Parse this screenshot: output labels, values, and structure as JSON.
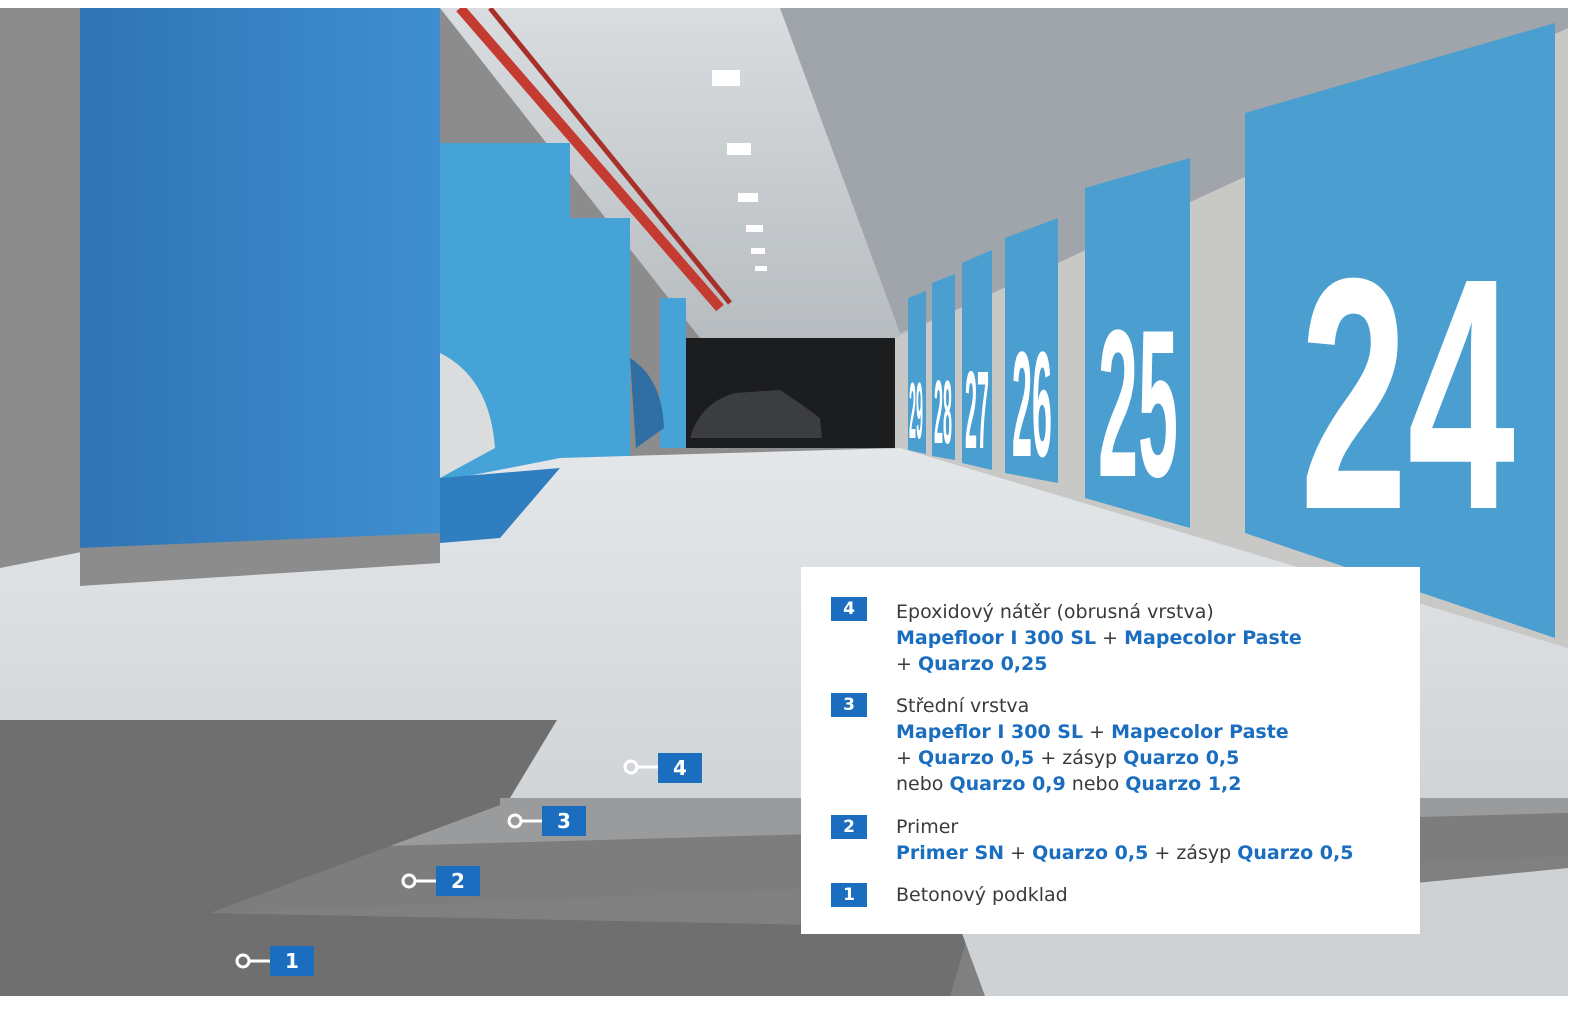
{
  "doors": [
    "24",
    "25",
    "26",
    "27",
    "28",
    "29"
  ],
  "floor_tags": [
    "4",
    "3",
    "2",
    "1"
  ],
  "legend": [
    {
      "num": "4",
      "title": "Epoxidový nátěr (obrusná vrstva)",
      "line1": [
        "Mapefloor I 300 SL",
        " + ",
        "Mapecolor Paste"
      ],
      "line2": [
        "+ ",
        "Quarzo 0,25"
      ]
    },
    {
      "num": "3",
      "title": "Střední vrstva",
      "line1": [
        "Mapeflor I 300 SL",
        " + ",
        "Mapecolor Paste"
      ],
      "line2": [
        "+ ",
        "Quarzo 0,5",
        " + zásyp ",
        "Quarzo 0,5"
      ],
      "line3": [
        "nebo ",
        "Quarzo 0,9",
        " nebo ",
        "Quarzo 1,2"
      ]
    },
    {
      "num": "2",
      "title": "Primer",
      "line1": [
        "Primer SN",
        " + ",
        "Quarzo 0,5",
        " + zásyp ",
        "Quarzo 0,5"
      ]
    },
    {
      "num": "1",
      "title": "Betonový podklad"
    }
  ],
  "colors": {
    "accent": "#1a6dbf",
    "wall_blue": "#4a9fd0",
    "column_blue": "#3a86c8"
  }
}
